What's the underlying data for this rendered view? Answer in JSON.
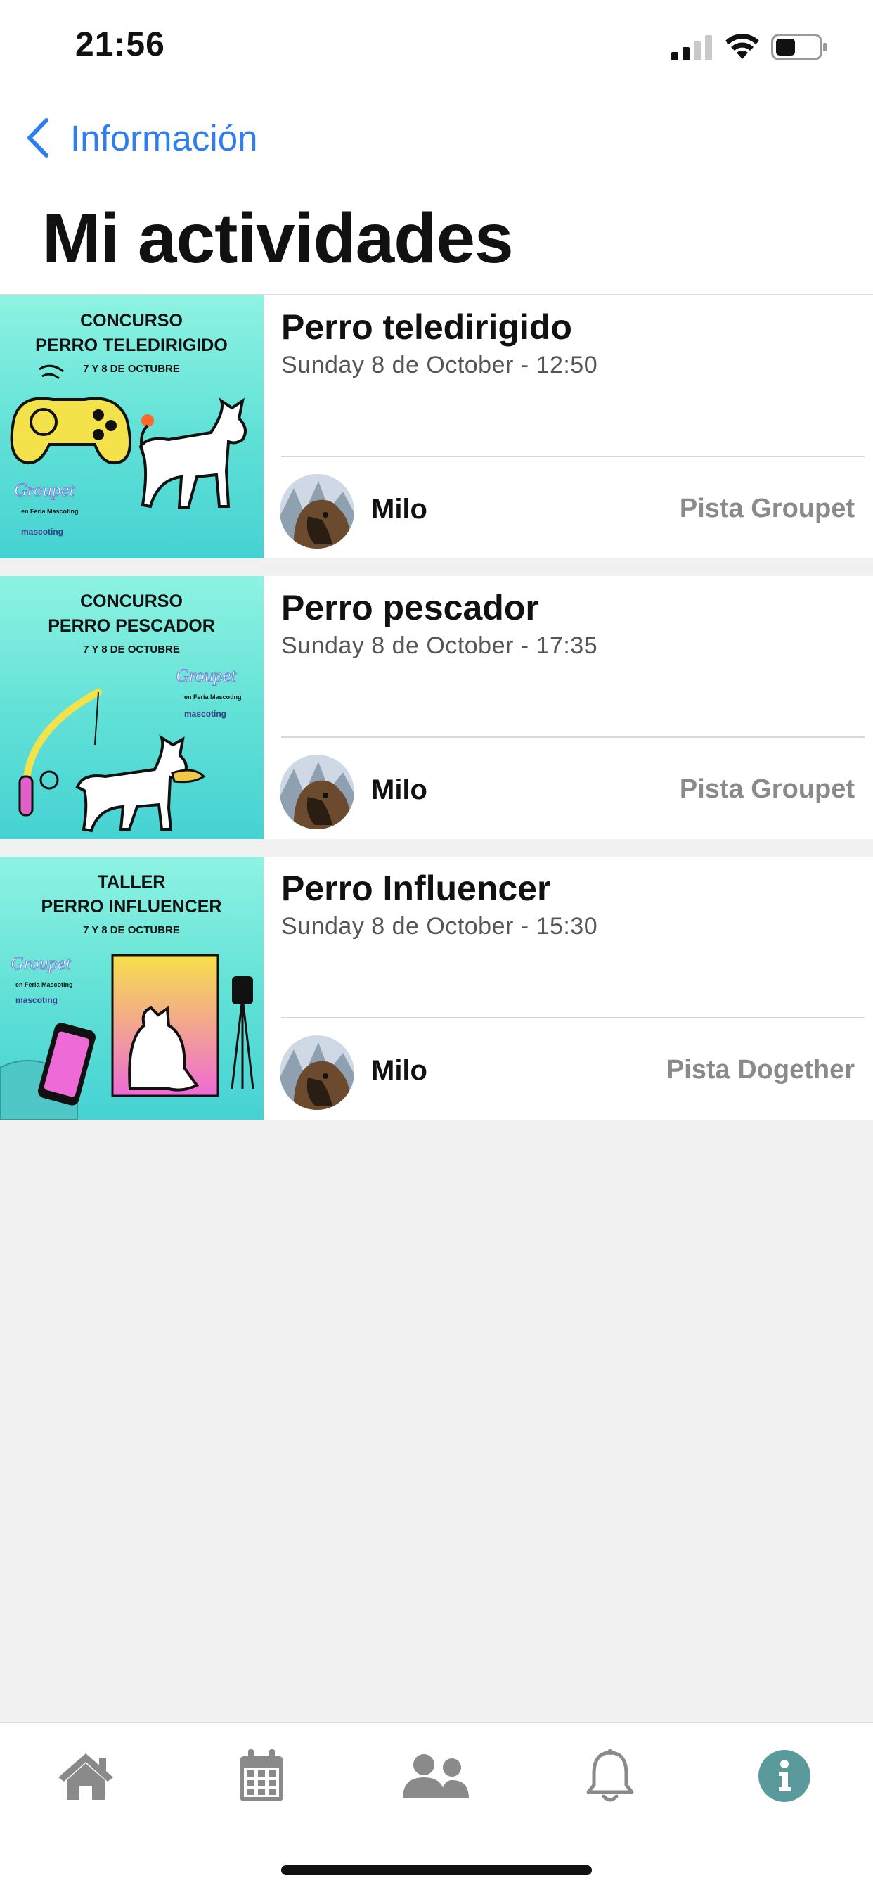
{
  "status_bar": {
    "time": "21:56"
  },
  "nav": {
    "back_label": "Información",
    "title": "Mi actividades"
  },
  "activities": [
    {
      "title": "Perro teledirigido",
      "datetime": "Sunday 8 de October - 12:50",
      "pet": "Milo",
      "place": "Pista Groupet",
      "poster": {
        "kind": "CONCURSO",
        "name": "PERRO TELEDIRIGIDO",
        "dates": "7 Y 8 DE OCTUBRE"
      }
    },
    {
      "title": "Perro pescador",
      "datetime": "Sunday 8 de October - 17:35",
      "pet": "Milo",
      "place": "Pista Groupet",
      "poster": {
        "kind": "CONCURSO",
        "name": "PERRO PESCADOR",
        "dates": "7 Y 8 DE OCTUBRE"
      }
    },
    {
      "title": "Perro Influencer",
      "datetime": "Sunday 8 de October - 15:30",
      "pet": "Milo",
      "place": "Pista Dogether",
      "poster": {
        "kind": "TALLER",
        "name": "PERRO INFLUENCER",
        "dates": "7 Y 8 DE OCTUBRE"
      }
    }
  ],
  "poster_branding": {
    "logo": "Groupet",
    "subtitle": "en Feria Mascoting",
    "sponsor": "mascoting"
  },
  "tabbar": {
    "items": [
      {
        "icon": "home-icon",
        "active": false
      },
      {
        "icon": "calendar-icon",
        "active": false
      },
      {
        "icon": "users-icon",
        "active": false
      },
      {
        "icon": "bell-icon",
        "active": false
      },
      {
        "icon": "info-icon",
        "active": true
      }
    ],
    "active_color": "#5a9a9c",
    "inactive_color": "#8a8a8a"
  },
  "colors": {
    "accent": "#2f7ef0",
    "poster_teal": "#5fe0d6"
  }
}
